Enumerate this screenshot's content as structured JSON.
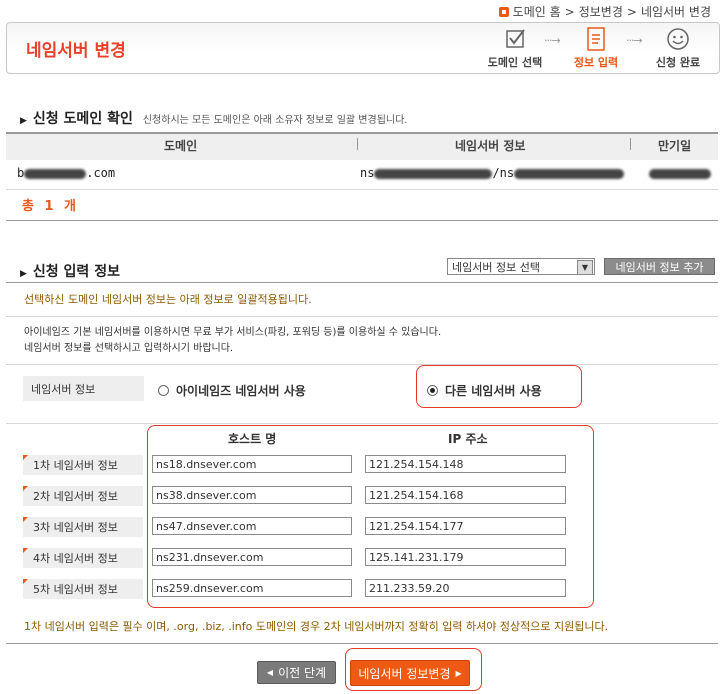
{
  "breadcrumb": {
    "items": [
      "도메인 홈",
      "정보변경",
      "네임서버 변경"
    ],
    "separator": ">"
  },
  "header": {
    "title": "네임서버 변경",
    "steps": [
      {
        "label": "도메인 선택",
        "icon": "checkbox-icon"
      },
      {
        "label": "정보 입력",
        "icon": "document-icon",
        "active": true
      },
      {
        "label": "신청 완료",
        "icon": "smiley-icon"
      }
    ]
  },
  "domain_section": {
    "title": "신청 도메인 확인",
    "subtitle": "신청하시는 모든 도메인은 아래 소유자 정보로 일괄 변경됩니다.",
    "columns": [
      "도메인",
      "네임서버 정보",
      "만기일"
    ],
    "row": {
      "domain_prefix": "b",
      "domain_suffix": ".com",
      "ns_prefix": "ns",
      "ns_mid": "/ns"
    },
    "total_label": "총 1 개"
  },
  "input_section": {
    "title": "신청 입력 정보",
    "select_value": "네임서버 정보 선택",
    "add_button": "네임서버 정보 추가",
    "notice": "선택하신 도메인 네임서버 정보는 아래 정보로 일괄적용됩니다.",
    "info_line1": "아이네임즈 기본 네임서버를 이용하시면 무료 부가 서비스(파킹, 포워딩 등)를 이용하실 수 있습니다.",
    "info_line2": "네임서버 정보를 선택하시고 입력하시기 바랍니다.",
    "ns_info_label": "네임서버 정보",
    "option_default": "아이네임즈 네임서버 사용",
    "option_other": "다른 네임서버 사용",
    "col_host": "호스트 명",
    "col_ip": "IP 주소",
    "nameservers": [
      {
        "label": "1차 네임서버 정보",
        "host": "ns18.dnsever.com",
        "ip": "121.254.154.148"
      },
      {
        "label": "2차 네임서버 정보",
        "host": "ns38.dnsever.com",
        "ip": "121.254.154.168"
      },
      {
        "label": "3차 네임서버 정보",
        "host": "ns47.dnsever.com",
        "ip": "121.254.154.177"
      },
      {
        "label": "4차 네임서버 정보",
        "host": "ns231.dnsever.com",
        "ip": "125.141.231.179"
      },
      {
        "label": "5차 네임서버 정보",
        "host": "ns259.dnsever.com",
        "ip": "211.233.59.20"
      }
    ],
    "footnote": "1차 네임서버 입력은 필수 이며, .org, .biz, .info 도메인의 경우 2차 네임서버까지 정확히 입력 하셔야 정상적으로 지원됩니다."
  },
  "buttons": {
    "prev": "이전 단계",
    "submit": "네임서버 정보변경"
  }
}
